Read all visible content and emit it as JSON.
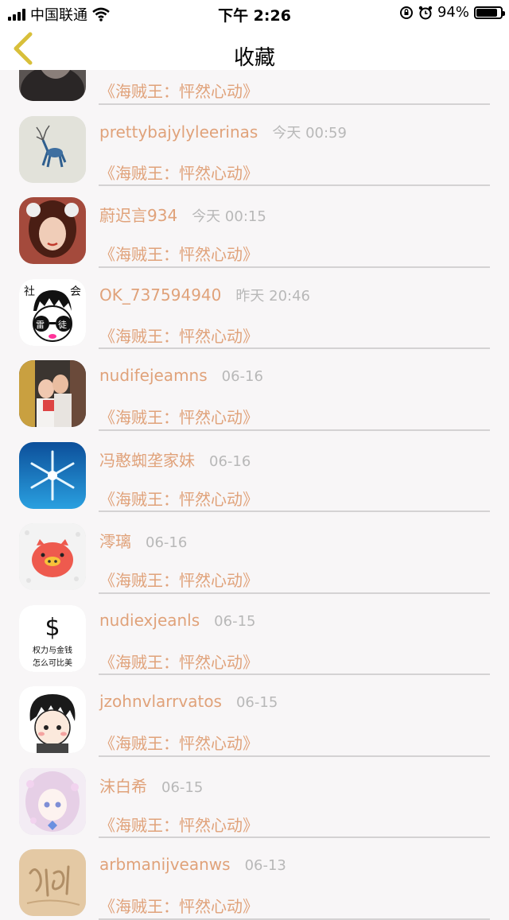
{
  "status_bar": {
    "carrier": "中国联通",
    "time": "下午 2:26",
    "battery": "94%",
    "battery_level": 0.94
  },
  "nav": {
    "title": "收藏",
    "back_icon": "chevron-left-icon"
  },
  "colors": {
    "accent": "#e0a27a",
    "muted": "#b8b8b8",
    "back": "#d8bf3a"
  },
  "items": [
    {
      "name": "",
      "time": "",
      "title": "《海贼王：怦然心动》"
    },
    {
      "name": "prettybajylyleerinas",
      "time": "今天 00:59",
      "title": "《海贼王：怦然心动》"
    },
    {
      "name": "蔚迟言934",
      "time": "今天 00:15",
      "title": "《海贼王：怦然心动》"
    },
    {
      "name": "OK_737594940",
      "time": "昨天 20:46",
      "title": "《海贼王：怦然心动》"
    },
    {
      "name": "nudifejeamns",
      "time": "06-16",
      "title": "《海贼王：怦然心动》"
    },
    {
      "name": "冯憨蜘垄家妹",
      "time": "06-16",
      "title": "《海贼王：怦然心动》"
    },
    {
      "name": "澪璃",
      "time": "06-16",
      "title": "《海贼王：怦然心动》"
    },
    {
      "name": "nudiexjeanls",
      "time": "06-15",
      "title": "《海贼王：怦然心动》"
    },
    {
      "name": "jzohnvlarrvatos",
      "time": "06-15",
      "title": "《海贼王：怦然心动》"
    },
    {
      "name": "沫白希",
      "time": "06-15",
      "title": "《海贼王：怦然心动》"
    },
    {
      "name": "arbmanijveanws",
      "time": "06-13",
      "title": "《海贼王：怦然心动》"
    }
  ],
  "avatar_texts": {
    "social": [
      "社",
      "会"
    ],
    "glasses": [
      "雷",
      "徒"
    ],
    "dollar": "$",
    "dollar_line1": "权力与金钱",
    "dollar_line2": "怎么可比美"
  }
}
